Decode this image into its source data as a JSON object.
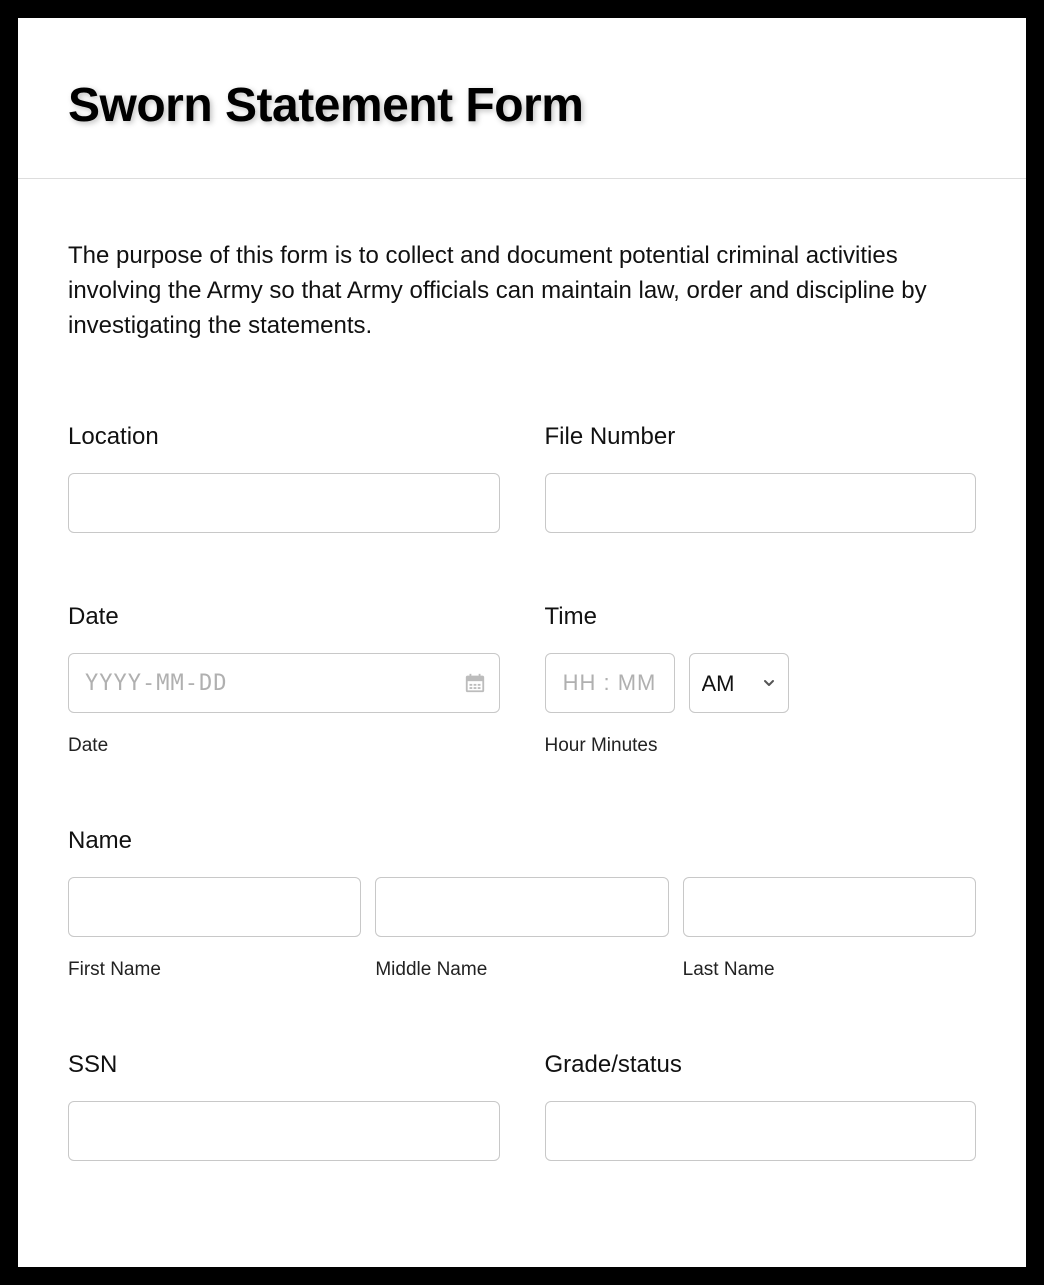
{
  "header": {
    "title": "Sworn Statement Form"
  },
  "description": "The purpose of this form is to collect and document potential criminal activities involving the Army so that Army officials can maintain law, order and discipline by investigating the statements.",
  "fields": {
    "location": {
      "label": "Location",
      "value": ""
    },
    "file_number": {
      "label": "File Number",
      "value": ""
    },
    "date": {
      "label": "Date",
      "placeholder": "YYYY-MM-DD",
      "value": "",
      "sub": "Date"
    },
    "time": {
      "label": "Time",
      "placeholder": "HH : MM",
      "value": "",
      "ampm": "AM",
      "sub": "Hour Minutes"
    },
    "name": {
      "label": "Name",
      "first": {
        "value": "",
        "sub": "First Name"
      },
      "middle": {
        "value": "",
        "sub": "Middle Name"
      },
      "last": {
        "value": "",
        "sub": "Last Name"
      }
    },
    "ssn": {
      "label": "SSN",
      "value": ""
    },
    "grade_status": {
      "label": "Grade/status",
      "value": ""
    }
  }
}
